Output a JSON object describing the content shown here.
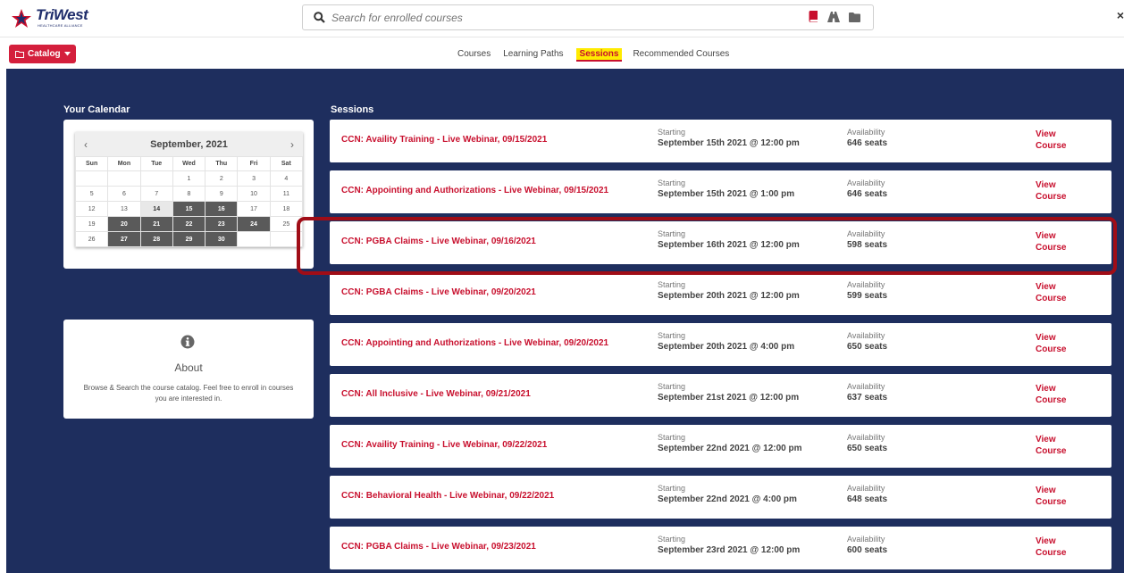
{
  "header": {
    "logo_text": "TriWest",
    "logo_sub": "HEALTHCARE ALLIANCE",
    "search_placeholder": "Search for enrolled courses",
    "close_label": "×"
  },
  "subbar": {
    "catalog_label": "Catalog",
    "tabs": [
      {
        "label": "Courses",
        "active": false
      },
      {
        "label": "Learning Paths",
        "active": false
      },
      {
        "label": "Sessions",
        "active": true
      },
      {
        "label": "Recommended Courses",
        "active": false
      }
    ]
  },
  "calendar": {
    "heading": "Your Calendar",
    "month_label": "September, 2021",
    "prev": "‹",
    "next": "›",
    "weekdays": [
      "Sun",
      "Mon",
      "Tue",
      "Wed",
      "Thu",
      "Fri",
      "Sat"
    ],
    "weeks": [
      [
        "",
        "",
        "",
        "1",
        "2",
        "3",
        "4"
      ],
      [
        "5",
        "6",
        "7",
        "8",
        "9",
        "10",
        "11"
      ],
      [
        "12",
        "13",
        "14",
        "15",
        "16",
        "17",
        "18"
      ],
      [
        "19",
        "20",
        "21",
        "22",
        "23",
        "24",
        "25"
      ],
      [
        "26",
        "27",
        "28",
        "29",
        "30",
        "",
        ""
      ]
    ],
    "today_days": [
      "14"
    ],
    "session_days": [
      "15",
      "16",
      "20",
      "21",
      "22",
      "23",
      "24",
      "27",
      "28",
      "29",
      "30"
    ]
  },
  "about": {
    "title": "About",
    "text": "Browse & Search the course catalog. Feel free to enroll in courses you are interested in."
  },
  "sessions": {
    "heading": "Sessions",
    "starting_label": "Starting",
    "availability_label": "Availability",
    "view_label_1": "View",
    "view_label_2": "Course",
    "items": [
      {
        "title": "CCN: Availity Training - Live Webinar, 09/15/2021",
        "start": "September 15th 2021 @ 12:00 pm",
        "seats": "646 seats"
      },
      {
        "title": "CCN: Appointing and Authorizations - Live Webinar, 09/15/2021",
        "start": "September 15th 2021 @ 1:00 pm",
        "seats": "646 seats"
      },
      {
        "title": "CCN: PGBA Claims - Live Webinar, 09/16/2021",
        "start": "September 16th 2021 @ 12:00 pm",
        "seats": "598 seats"
      },
      {
        "title": "CCN: PGBA Claims - Live Webinar, 09/20/2021",
        "start": "September 20th 2021 @ 12:00 pm",
        "seats": "599 seats"
      },
      {
        "title": "CCN: Appointing and Authorizations - Live Webinar, 09/20/2021",
        "start": "September 20th 2021 @ 4:00 pm",
        "seats": "650 seats"
      },
      {
        "title": "CCN: All Inclusive - Live Webinar, 09/21/2021",
        "start": "September 21st 2021 @ 12:00 pm",
        "seats": "637 seats"
      },
      {
        "title": "CCN: Availity Training - Live Webinar, 09/22/2021",
        "start": "September 22nd 2021 @ 12:00 pm",
        "seats": "650 seats"
      },
      {
        "title": "CCN: Behavioral Health - Live Webinar, 09/22/2021",
        "start": "September 22nd 2021 @ 4:00 pm",
        "seats": "648 seats"
      },
      {
        "title": "CCN: PGBA Claims - Live Webinar, 09/23/2021",
        "start": "September 23rd 2021 @ 12:00 pm",
        "seats": "600 seats"
      }
    ]
  },
  "colors": {
    "accent": "#c8102e",
    "navy": "#1e2e5e",
    "highlight_box": "#a00d17",
    "active_tab_bg": "#ffeb00"
  },
  "icons": [
    "star-logo-icon",
    "search-icon",
    "book-icon",
    "road-icon",
    "folder-icon",
    "folder-outline-icon",
    "caret-down-icon",
    "info-circle-icon"
  ]
}
